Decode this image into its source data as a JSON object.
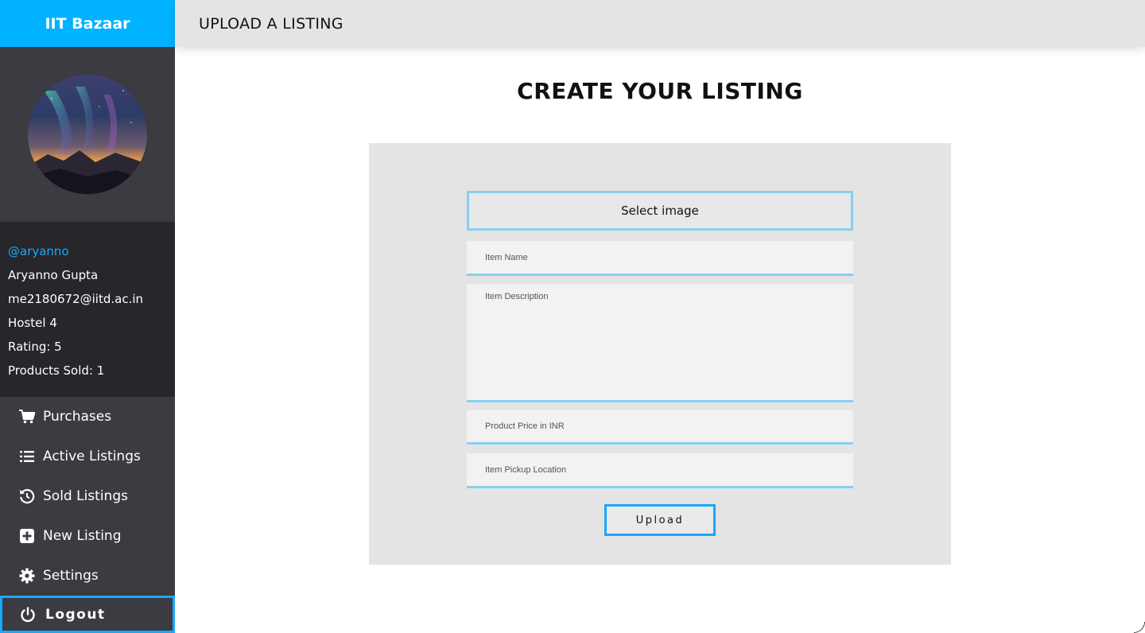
{
  "app": {
    "brand": "IIT Bazaar",
    "accent": "#00b2ff"
  },
  "header": {
    "title": "UPLOAD A LISTING"
  },
  "profile": {
    "handle": "@aryanno",
    "name": "Aryanno Gupta",
    "email": "me2180672@iitd.ac.in",
    "hostel": "Hostel 4",
    "rating": "Rating: 5",
    "products_sold": "Products Sold: 1"
  },
  "sidebar": {
    "items": [
      {
        "label": "Purchases",
        "icon": "cart-icon"
      },
      {
        "label": "Active Listings",
        "icon": "list-icon"
      },
      {
        "label": "Sold Listings",
        "icon": "history-icon"
      },
      {
        "label": "New Listing",
        "icon": "plus-square-icon"
      },
      {
        "label": "Settings",
        "icon": "gear-icon"
      }
    ],
    "logout": {
      "label": "Logout",
      "icon": "power-icon"
    }
  },
  "main": {
    "title": "CREATE YOUR LISTING",
    "form": {
      "select_image_label": "Select image",
      "item_name_placeholder": "Item Name",
      "item_description_placeholder": "Item Description",
      "price_placeholder": "Product Price in INR",
      "location_placeholder": "Item Pickup Location",
      "upload_label": "Upload"
    }
  }
}
